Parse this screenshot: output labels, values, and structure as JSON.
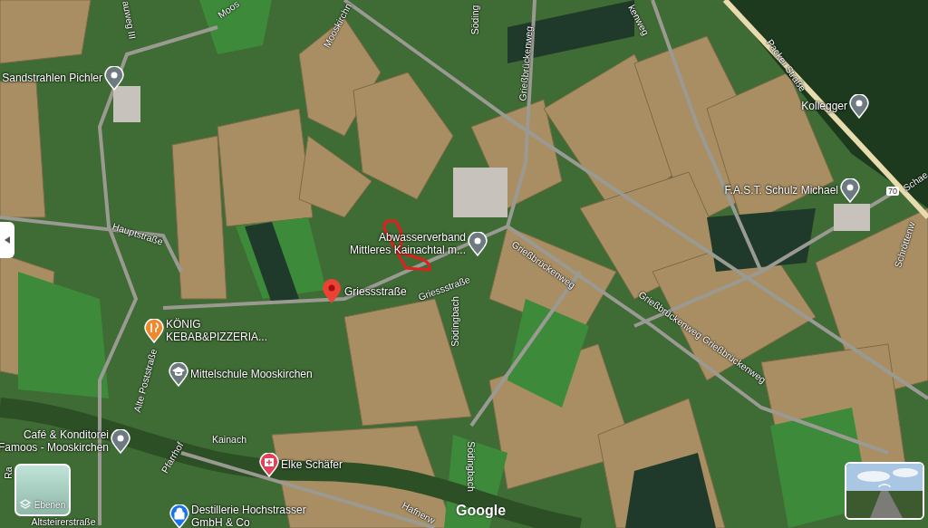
{
  "pois": [
    {
      "lines": [
        "Sandstrahlen Pichler"
      ],
      "kind": "place"
    },
    {
      "lines": [
        "Kollegger"
      ],
      "kind": "place"
    },
    {
      "lines": [
        "F.A.S.T. Schulz Michael"
      ],
      "kind": "place"
    },
    {
      "lines": [
        "Abwasserverband",
        "Mittleres Kainachtal m..."
      ],
      "kind": "place"
    },
    {
      "lines": [
        "KÖNIG",
        "KEBAB&PIZZERIA..."
      ],
      "kind": "restaurant"
    },
    {
      "lines": [
        "Mittelschule Mooskirchen"
      ],
      "kind": "school"
    },
    {
      "lines": [
        "Café & Konditorei",
        "Famoos - Mooskirchen"
      ],
      "kind": "place"
    },
    {
      "lines": [
        "Elke Schäfer"
      ],
      "kind": "medical"
    },
    {
      "lines": [
        "Destillerie Hochstrasser",
        "GmbH & Co"
      ],
      "kind": "shop"
    }
  ],
  "selected_place": {
    "name": "Griessstraße"
  },
  "streets": [
    "auweg III",
    "Moos",
    "Mooskirchn",
    "Söding",
    "Grießbrückenweg",
    "kenweg",
    "Packer Straße",
    "Schae",
    "Schröttenw",
    "Hauptstraße",
    "Griessstraße",
    "Grießbrückenweg",
    "Grießbrückenweg Grießbrückenweg",
    "Södingbach",
    "Södingbach",
    "Alte Poststraße",
    "Kainach",
    "Pfarrhof",
    "Hafnerw",
    "Altsteirerstraße",
    "Ra"
  ],
  "route_shield": "70",
  "layers_button": {
    "label": "Ebenen"
  },
  "logo": "Google"
}
